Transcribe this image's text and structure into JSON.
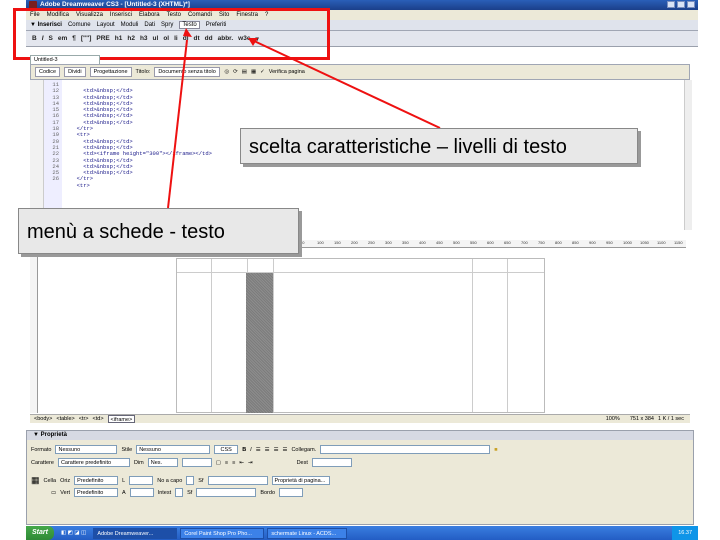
{
  "window": {
    "title": "Adobe Dreamweaver CS3 - [Untitled-3 (XHTML)*]"
  },
  "menu": [
    "File",
    "Modifica",
    "Visualizza",
    "Inserisci",
    "Elabora",
    "Testo",
    "Comandi",
    "Sito",
    "Finestra",
    "?"
  ],
  "insert_bar": {
    "header": "▼ Inserisci",
    "tabs": [
      "Comune",
      "Layout",
      "Moduli",
      "Dati",
      "Spry",
      "Testo",
      "Preferiti"
    ]
  },
  "text_toolbar": [
    "B",
    "I",
    "S",
    "em",
    "¶",
    "[\"\"]",
    "PRE",
    "h1",
    "h2",
    "h3",
    "ul",
    "ol",
    "li",
    "dl",
    "dt",
    "dd",
    "abbr.",
    "w3c"
  ],
  "doc": {
    "tab": "Untitled-3",
    "buttons": [
      "Codice",
      "Dividi",
      "Progettazione"
    ],
    "title_label": "Titolo:",
    "title_value": "Documento senza titolo",
    "check_page": "Verifica pagina"
  },
  "code_lines": {
    "numbers": [
      "11",
      "12",
      "13",
      "14",
      "15",
      "16",
      "17",
      "18",
      "19",
      "20",
      "21",
      "22",
      "23",
      "24",
      "25",
      "26"
    ],
    "text": [
      "    <td>&nbsp;</td>",
      "    <td>&nbsp;</td>",
      "    <td>&nbsp;</td>",
      "    <td>&nbsp;</td>",
      "    <td>&nbsp;</td>",
      "    <td>&nbsp;</td>",
      "  </tr>",
      "  <tr>",
      "    <td>&nbsp;</td>",
      "    <td>&nbsp;</td>",
      "    <td><iframe height=\"300\"></iframe></td>",
      "    <td>&nbsp;</td>",
      "    <td>&nbsp;</td>",
      "    <td>&nbsp;</td>",
      "  </tr>",
      "  <tr>"
    ]
  },
  "ruler": [
    "50",
    "100",
    "150",
    "200",
    "250",
    "300",
    "350",
    "400",
    "450",
    "500",
    "550",
    "600",
    "650",
    "700",
    "750",
    "800",
    "850",
    "900",
    "950",
    "1000",
    "1050",
    "1100",
    "1150",
    "1200"
  ],
  "status": {
    "tags": [
      "<body>",
      "<table>",
      "<tr>",
      "<td>",
      "<iframe>"
    ],
    "zoom": "100%",
    "size": "751 x 384",
    "weight": "1 K / 1 sec"
  },
  "properties": {
    "header": "▼ Proprietà",
    "formato_label": "Formato",
    "formato_value": "Nessuno",
    "stile_label": "Stile",
    "stile_value": "Nessuno",
    "css_label": "CSS",
    "collegamento_label": "Collegam.",
    "carattere_label": "Carattere",
    "carattere_value": "Carattere predefinito",
    "dim_label": "Dim",
    "dim_value": "Nes.",
    "dest_label": "Dest",
    "cella_label": "Cella",
    "orizz_label": "Oriz",
    "orizz_value": "Predefinito",
    "vert_label": "Vert",
    "vert_value": "Predefinito",
    "l_label": "L",
    "a_label": "A",
    "noacapo_label": "No a capo",
    "intest_label": "Intest",
    "sf_label": "Sf",
    "bordo_label": "Bordo",
    "page_props": "Proprietà di pagina..."
  },
  "taskbar": {
    "start": "Start",
    "tasks": [
      "Adobe Dreamweaver...",
      "Corel Paint Shop Pro Pho...",
      "schermate Linux - ACDS..."
    ],
    "time": "16.37"
  },
  "callouts": {
    "levels": "scelta caratteristiche – livelli di testo",
    "tabs_menu": "menù a schede - testo"
  },
  "colors": {
    "callout_border": "#e11111",
    "titlebar": "#1b3f8a"
  }
}
